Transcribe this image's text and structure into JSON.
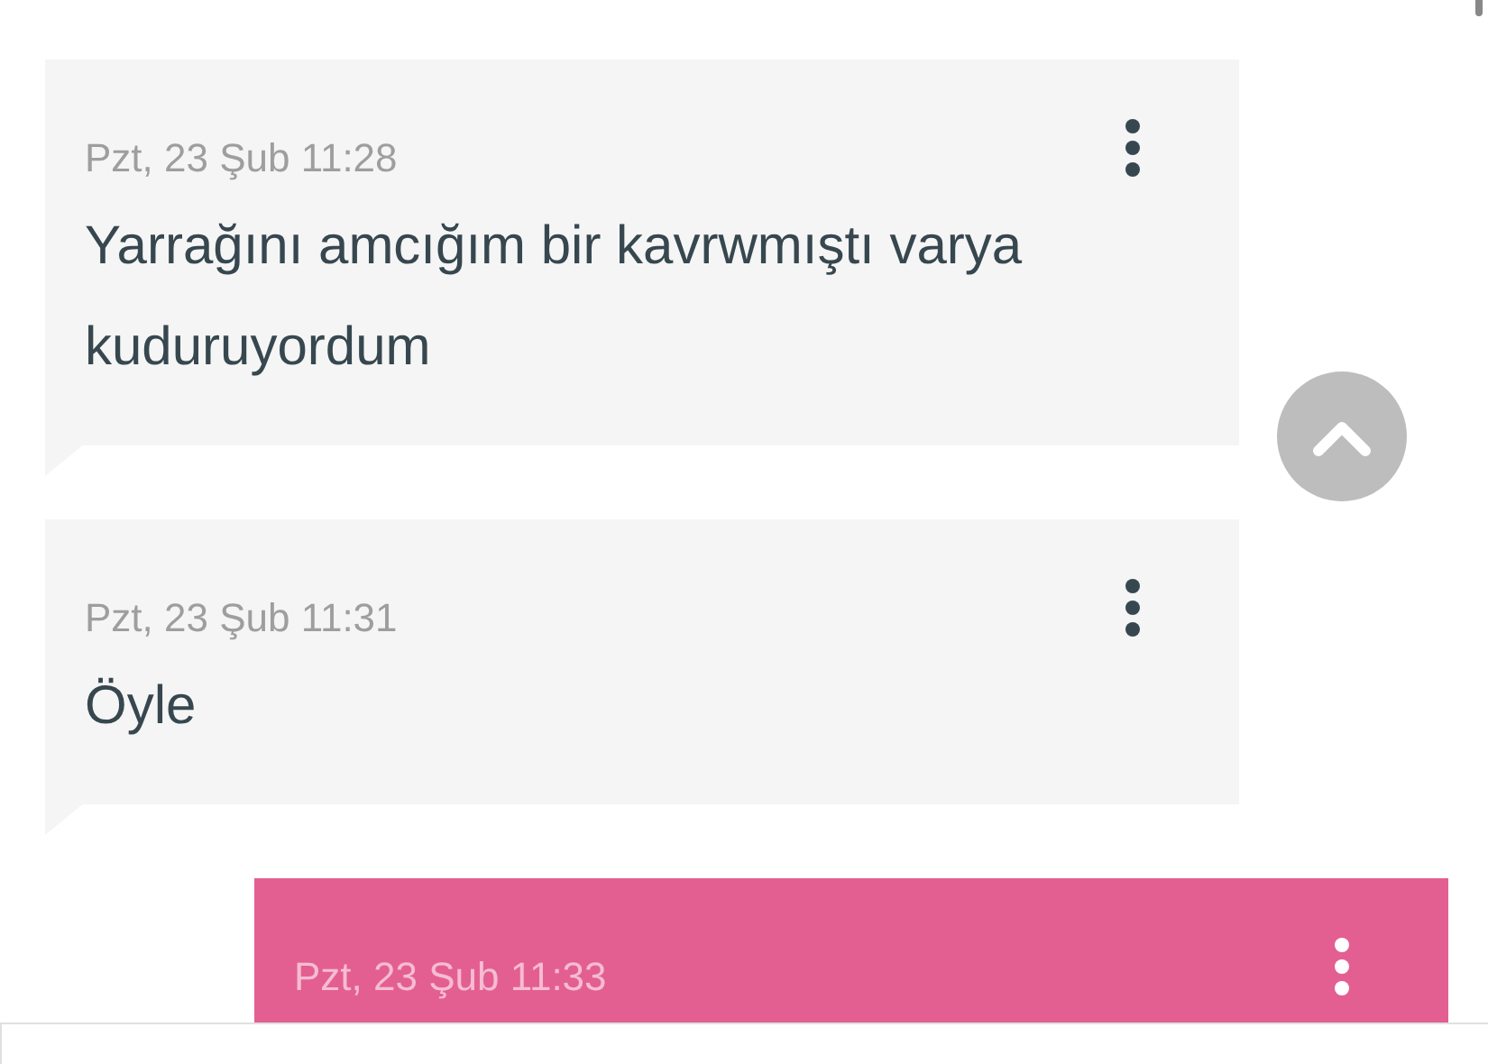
{
  "messages": [
    {
      "kind": "received",
      "time": "Pzt, 23 Şub 11:28",
      "text": "Yarrağını amcığım bir kavrwmıştı varya kuduruyordum"
    },
    {
      "kind": "received",
      "time": "Pzt, 23 Şub 11:31",
      "text": "Öyle"
    },
    {
      "kind": "sent",
      "time": "Pzt, 23 Şub 11:33"
    }
  ]
}
